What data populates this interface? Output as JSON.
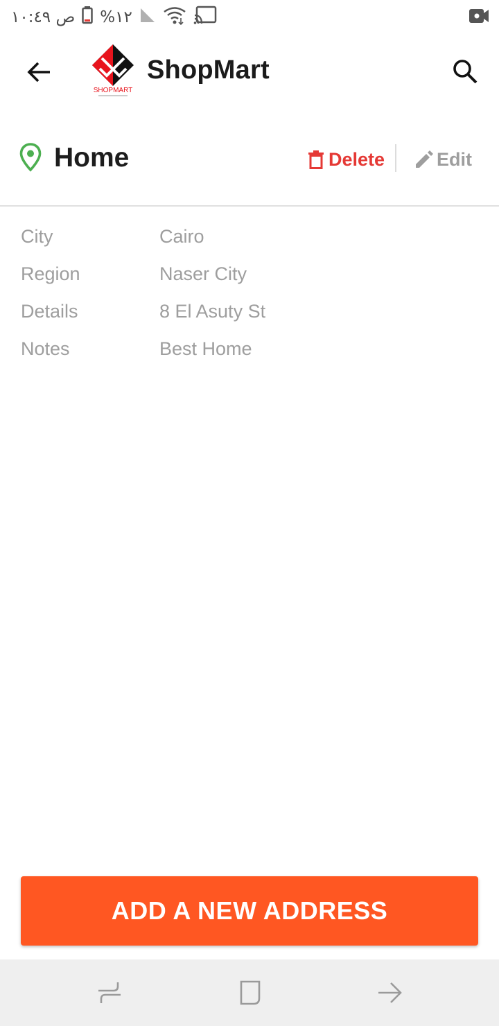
{
  "status_bar": {
    "time": "ص ١٠:٤٩",
    "battery": "%١٢",
    "icons": [
      "battery-icon",
      "signal-icon",
      "wifi-icon",
      "cast-icon",
      "video-record-icon"
    ]
  },
  "app_bar": {
    "title": "ShopMart",
    "logo_text": "SHOPMART",
    "icons": [
      "back-arrow-icon",
      "search-icon"
    ]
  },
  "address": {
    "title": "Home",
    "delete_label": "Delete",
    "edit_label": "Edit",
    "rows": [
      {
        "label": "City",
        "value": "Cairo"
      },
      {
        "label": "Region",
        "value": "Naser City"
      },
      {
        "label": "Details",
        "value": "8 El Asuty St"
      },
      {
        "label": "Notes",
        "value": "Best Home"
      }
    ]
  },
  "add_button_label": "ADD A NEW ADDRESS",
  "nav_bar": {
    "icons": [
      "recent-apps-icon",
      "home-icon",
      "back-icon"
    ]
  },
  "colors": {
    "accent": "#ff5722",
    "delete": "#e53935",
    "pin": "#4caf50",
    "muted_text": "#9e9e9e",
    "nav_background": "#efefef"
  }
}
